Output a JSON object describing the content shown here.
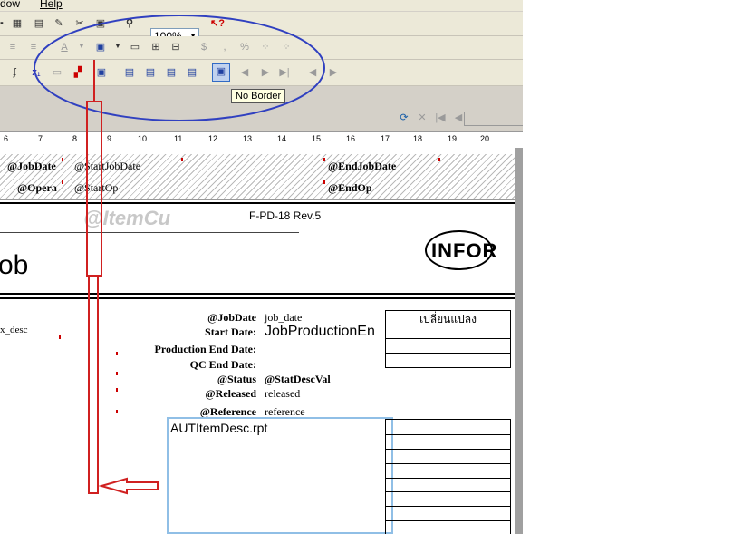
{
  "menu": {
    "item_window": "dow",
    "item_help": "Help"
  },
  "toolbar": {
    "zoom_value": "100%"
  },
  "tooltip": {
    "text": "No Border"
  },
  "ruler": {
    "marks": [
      "6",
      "7",
      "8",
      "9",
      "10",
      "11",
      "12",
      "13",
      "14",
      "15",
      "16",
      "17",
      "18",
      "19",
      "20"
    ]
  },
  "report": {
    "header_fields": {
      "job_date": "@JobDate",
      "start_job_date": "@StartJobDate",
      "end_job_date": "@EndJobDate",
      "opera": "@Opera",
      "start_op": "@StartOp",
      "end_op": "@EndOp"
    },
    "item_cu": "@ItemCu",
    "form_code": "F-PD-18 Rev.5",
    "logo_text": "INFOR",
    "title_fragment": "ob",
    "x_desc": "x_desc",
    "labels": {
      "job_date": "@JobDate",
      "start_date": "Start Date:",
      "production_end_date": "Production End Date:",
      "qc_end_date": "QC End Date:",
      "status": "@Status",
      "released": "@Released",
      "reference": "@Reference"
    },
    "values": {
      "job_date": "job_date",
      "job_production_end": "JobProductionEn",
      "stat_desc_val": "@StatDescVal",
      "released": "released",
      "reference": "reference"
    },
    "change_header": "เปลี่ยนแปลง",
    "subreport": "AUTItemDesc.rpt"
  }
}
